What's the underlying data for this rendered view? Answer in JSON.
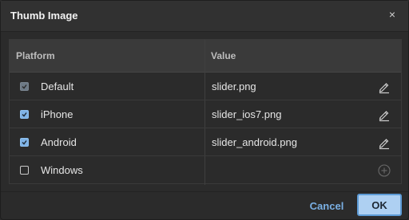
{
  "dialog": {
    "title": "Thumb Image",
    "close_label": "×"
  },
  "table": {
    "headers": {
      "platform": "Platform",
      "value": "Value"
    },
    "rows": [
      {
        "platform": "Default",
        "value": "slider.png",
        "check_state": "checked-disabled",
        "action_icon": "edit-pencil-icon"
      },
      {
        "platform": "iPhone",
        "value": "slider_ios7.png",
        "check_state": "checked",
        "action_icon": "edit-pencil-icon"
      },
      {
        "platform": "Android",
        "value": "slider_android.png",
        "check_state": "checked",
        "action_icon": "edit-pencil-icon"
      },
      {
        "platform": "Windows",
        "value": "",
        "check_state": "unchecked",
        "action_icon": "add-circle-icon"
      }
    ]
  },
  "footer": {
    "cancel_label": "Cancel",
    "ok_label": "OK"
  },
  "colors": {
    "accent": "#7ab0e4",
    "ok_background": "#aed0f2",
    "checkbox_checked": "#7fb3e6"
  }
}
